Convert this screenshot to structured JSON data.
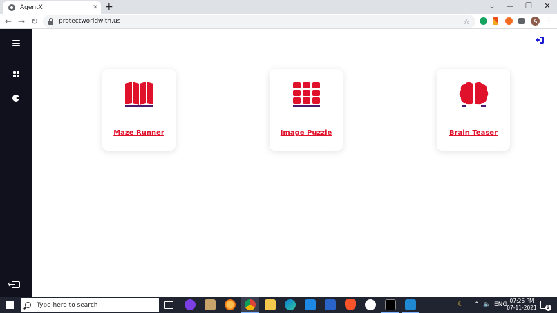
{
  "browser": {
    "tab_title": "AgentX",
    "tab_close": "✕",
    "new_tab": "+",
    "url": "protectworldwith.us",
    "profile_initial": "A",
    "window_controls": {
      "tabs_menu": "⌄",
      "minimize": "—",
      "restore": "❐",
      "close": "✕"
    }
  },
  "sidebar": {
    "items": [
      {
        "icon": "hamburger-menu-icon"
      },
      {
        "icon": "dashboard-grid-icon"
      },
      {
        "icon": "pacman-icon"
      }
    ],
    "bottom_icon": "logout-icon"
  },
  "main": {
    "exit_icon": "exit-door-icon",
    "accent_color": "#e0112b",
    "icon_shadow_color": "#4b1a6e",
    "cards": [
      {
        "label": "Maze Runner",
        "icon": "book-map-icon"
      },
      {
        "label": "Image Puzzle",
        "icon": "puzzle-grid-icon"
      },
      {
        "label": "Brain Teaser",
        "icon": "brain-icon"
      }
    ]
  },
  "taskbar": {
    "search_placeholder": "Type here to search",
    "language": "ENG",
    "time": "07:26 PM",
    "date": "07-11-2021",
    "notification_count": "2"
  }
}
